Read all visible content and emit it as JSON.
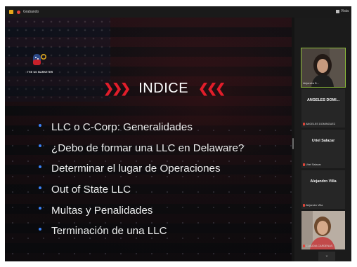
{
  "topbar": {
    "recording_label": "Grabando",
    "view_label": "Vista"
  },
  "slide": {
    "logo_text": "THE US MARKETER",
    "left_chevrons": "❯❯❯",
    "title": "INDICE",
    "right_chevrons": "❮❮❮",
    "items": [
      "LLC o C-Corp: Generalidades",
      "¿Debo de formar una LLC en Delaware?",
      "Determinar el lugar de Operaciones",
      "Out of State LLC",
      "Multas y Penalidades",
      "Terminación de una LLC"
    ]
  },
  "participants": [
    {
      "display_name": "",
      "label": "Alejandra B..."
    },
    {
      "display_name": "ANGELES DOMI...",
      "label": "ANGELES DOMINGUEZ"
    },
    {
      "display_name": "Uriel Salazar",
      "label": "Uriel Salazar"
    },
    {
      "display_name": "Alejandro Villa",
      "label": "Alejandro Villa"
    },
    {
      "display_name": "",
      "label": "CLAUDIA CARDENAS"
    }
  ],
  "panel": {
    "more_icon": "chevron-down-icon",
    "more_glyph": "⌄"
  },
  "colors": {
    "accent_red": "#e11d2a",
    "bullet_blue": "#3b82f6",
    "active_speaker": "#8dbd3a"
  }
}
